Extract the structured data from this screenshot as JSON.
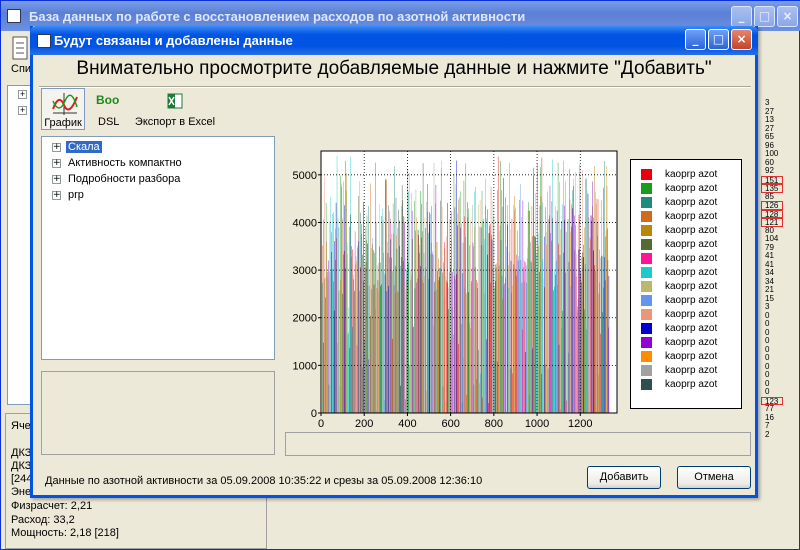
{
  "main_window": {
    "title": "База данных по работе с восстановлением расходов по азотной активности",
    "toolbar_label": "Спи",
    "bottom_lines": [
      "Яче",
      "ДКЗ",
      "ДКЗ",
      "[244",
      "Эне",
      "Физрасчет: 2,21",
      "Расход: 33,2",
      "Мощность: 2,18 [218]"
    ],
    "right_numbers": [
      "3",
      "27",
      "13",
      "27",
      "65",
      "96",
      "100",
      "60",
      "92",
      "151",
      "135",
      "85",
      "126",
      "128",
      "121",
      "80",
      "104",
      "79",
      "41",
      "41",
      "34",
      "34",
      "21",
      "15",
      "3",
      "0",
      "0",
      "0",
      "0",
      "0",
      "0",
      "0",
      "0",
      "0",
      "0",
      "123",
      "77",
      "16",
      "7",
      "2"
    ],
    "boxed_numbers_indices": [
      9,
      10,
      12,
      13,
      14,
      35
    ]
  },
  "dialog": {
    "title": "Будут связаны и добавлены данные",
    "heading": "Внимательно просмотрите добавляемые данные и нажмите \"Добавить\"",
    "toolbar": {
      "graph_label": "График",
      "boo_label": "Boo",
      "dsl_label": "DSL",
      "excel_label": "Экспорт в Excel"
    },
    "tree": [
      {
        "label": "Скала",
        "selected": true
      },
      {
        "label": "Активность компактно",
        "selected": false
      },
      {
        "label": "Подробности разбора",
        "selected": false
      },
      {
        "label": "prp",
        "selected": false
      }
    ],
    "status_text": "Данные по азотной активности за 05.09.2008 10:35:22 и срезы за 05.09.2008 12:36:10",
    "add_button": "Добавить",
    "cancel_button": "Отмена"
  },
  "chart_data": {
    "type": "bar",
    "xlim": [
      0,
      1370
    ],
    "ylim": [
      0,
      5500
    ],
    "x_ticks": [
      0,
      200,
      400,
      600,
      800,
      1000,
      1200
    ],
    "y_ticks": [
      0,
      1000,
      2000,
      3000,
      4000,
      5000
    ],
    "grid": true,
    "legend_position": "right",
    "series": [
      {
        "name": "kaoprp_azot",
        "color": "#e8000b"
      },
      {
        "name": "kaoprp_azot",
        "color": "#1a9c1a"
      },
      {
        "name": "kaoprp_azot",
        "color": "#1f8b7f"
      },
      {
        "name": "kaoprp_azot",
        "color": "#d2691e"
      },
      {
        "name": "kaoprp_azot",
        "color": "#b8860b"
      },
      {
        "name": "kaoprp_azot",
        "color": "#556b2f"
      },
      {
        "name": "kaoprp_azot",
        "color": "#ff1493"
      },
      {
        "name": "kaoprp_azot",
        "color": "#20c8c8"
      },
      {
        "name": "kaoprp_azot",
        "color": "#bdb76b"
      },
      {
        "name": "kaoprp_azot",
        "color": "#6495ed"
      },
      {
        "name": "kaoprp_azot",
        "color": "#e9967a"
      },
      {
        "name": "kaoprp_azot",
        "color": "#0000cd"
      },
      {
        "name": "kaoprp_azot",
        "color": "#9400d3"
      },
      {
        "name": "kaoprp_azot",
        "color": "#ff8c00"
      },
      {
        "name": "kaoprp_azot",
        "color": "#a0a0a0"
      },
      {
        "name": "kaoprp_azot",
        "color": "#2f4f4f"
      }
    ],
    "peak_max": 5400,
    "typical_band": [
      2500,
      4500
    ]
  }
}
